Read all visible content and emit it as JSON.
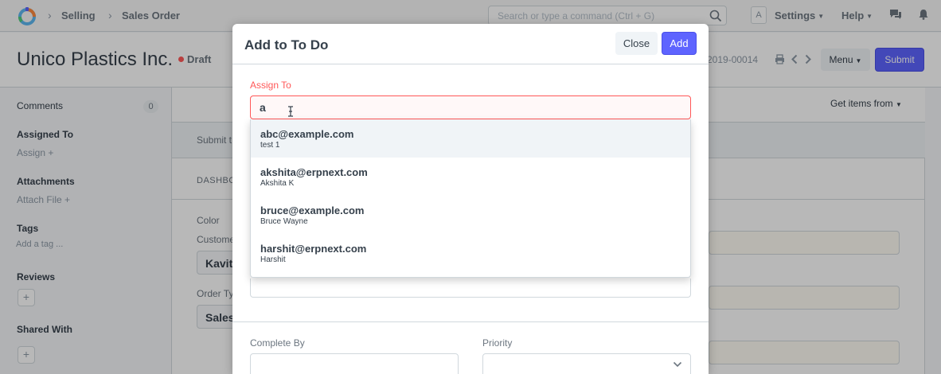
{
  "navbar": {
    "breadcrumbs": [
      "Selling",
      "Sales Order"
    ],
    "search_placeholder": "Search or type a command (Ctrl + G)",
    "avatar_letter": "A",
    "settings_label": "Settings",
    "help_label": "Help"
  },
  "page": {
    "title": "Unico Plastics Inc.",
    "status": "Draft",
    "doc_name_partial": "2019-00014",
    "menu_label": "Menu",
    "submit_label": "Submit"
  },
  "sidebar": {
    "comments_label": "Comments",
    "comments_count": "0",
    "assigned_to_label": "Assigned To",
    "assign_label": "Assign",
    "attachments_label": "Attachments",
    "attach_file_label": "Attach File",
    "tags_label": "Tags",
    "add_tag_label": "Add a tag ...",
    "reviews_label": "Reviews",
    "shared_with_label": "Shared With"
  },
  "form": {
    "get_items_label": "Get items from",
    "submit_strip_text": "Submit t",
    "dashboard_label": "DASHBO",
    "color_label": "Color",
    "customer_label": "Custome",
    "customer_value": "Kavit",
    "order_type_label": "Order Ty",
    "order_type_value": "Sales"
  },
  "modal": {
    "title": "Add to To Do",
    "close_label": "Close",
    "add_label": "Add",
    "assign_to_label": "Assign To",
    "assign_to_value": "a",
    "complete_by_label": "Complete By",
    "priority_label": "Priority",
    "suggestions": [
      {
        "email": "abc@example.com",
        "name": "test 1"
      },
      {
        "email": "akshita@erpnext.com",
        "name": "Akshita K"
      },
      {
        "email": "bruce@example.com",
        "name": "Bruce Wayne"
      },
      {
        "email": "harshit@erpnext.com",
        "name": "Harshit"
      }
    ]
  },
  "colors": {
    "primary": "#5e64ff",
    "error": "#ff5858",
    "text": "#36414c"
  }
}
